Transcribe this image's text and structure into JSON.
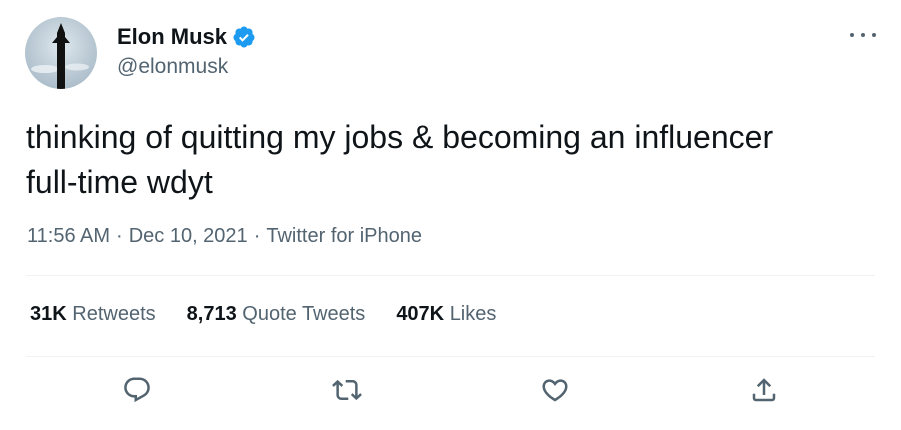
{
  "tweet": {
    "author": {
      "name": "Elon Musk",
      "handle": "@elonmusk"
    },
    "text_line1": "thinking of quitting my jobs & becoming an influencer",
    "text_line2": "full-time wdyt",
    "time": "11:56 AM",
    "date": "Dec 10, 2021",
    "separator": "·",
    "source": "Twitter for iPhone"
  },
  "stats": {
    "retweets_count": "31K",
    "retweets_label": "Retweets",
    "quotes_count": "8,713",
    "quotes_label": "Quote Tweets",
    "likes_count": "407K",
    "likes_label": "Likes"
  },
  "icons": {
    "verified": "verified-badge-icon",
    "more": "more-options-icon",
    "reply": "reply-icon",
    "retweet": "retweet-icon",
    "like": "like-icon",
    "share": "share-icon"
  },
  "colors": {
    "text": "#0f1419",
    "secondary": "#536471",
    "verified": "#1d9bf0",
    "divider": "#eff3f4"
  }
}
